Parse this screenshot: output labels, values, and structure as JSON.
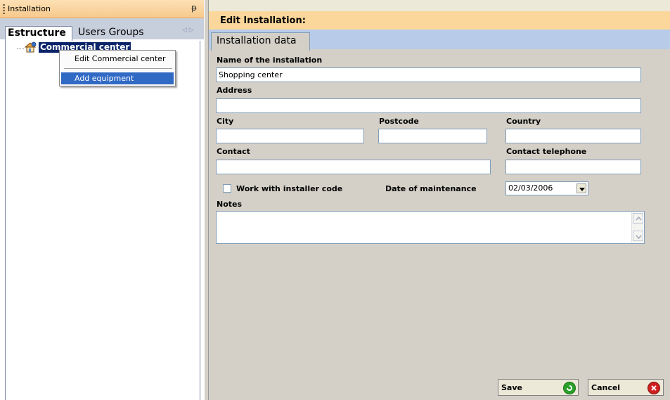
{
  "left_panel": {
    "title": "Installation",
    "pin_glyph": "ᵽ",
    "tabs": [
      "Estructure",
      "Users Groups"
    ],
    "tab_arrows": "◁ ▷",
    "tree": {
      "node_label": "Commercial center",
      "node_icon": "building-icon"
    }
  },
  "context_menu": {
    "items": [
      "Edit Commercial center",
      "Add equipment"
    ],
    "highlighted": "Add equipment"
  },
  "edit": {
    "title": "Edit Installation:",
    "tab": "Installation data",
    "labels": {
      "name": "Name of the installation",
      "address": "Address",
      "city": "City",
      "postcode": "Postcode",
      "country": "Country",
      "contact": "Contact",
      "contact_telephone": "Contact telephone",
      "installer_code": "Work with installer code",
      "date_maintenance": "Date of maintenance",
      "notes": "Notes"
    },
    "values": {
      "name": "Shopping center",
      "address": "",
      "city": "",
      "postcode": "",
      "country": "",
      "contact": "",
      "contact_telephone": "",
      "installer_code_checked": false,
      "date_maintenance": "02/03/2006",
      "notes": ""
    },
    "buttons": {
      "save": "Save",
      "cancel": "Cancel"
    }
  },
  "colors": {
    "header_orange": "#fbd79b",
    "tab_blue": "#b8cbe8",
    "selection": "#0a246a",
    "menu_highlight": "#316ac5",
    "save_icon": "#2aa02a",
    "cancel_icon": "#d02020"
  }
}
